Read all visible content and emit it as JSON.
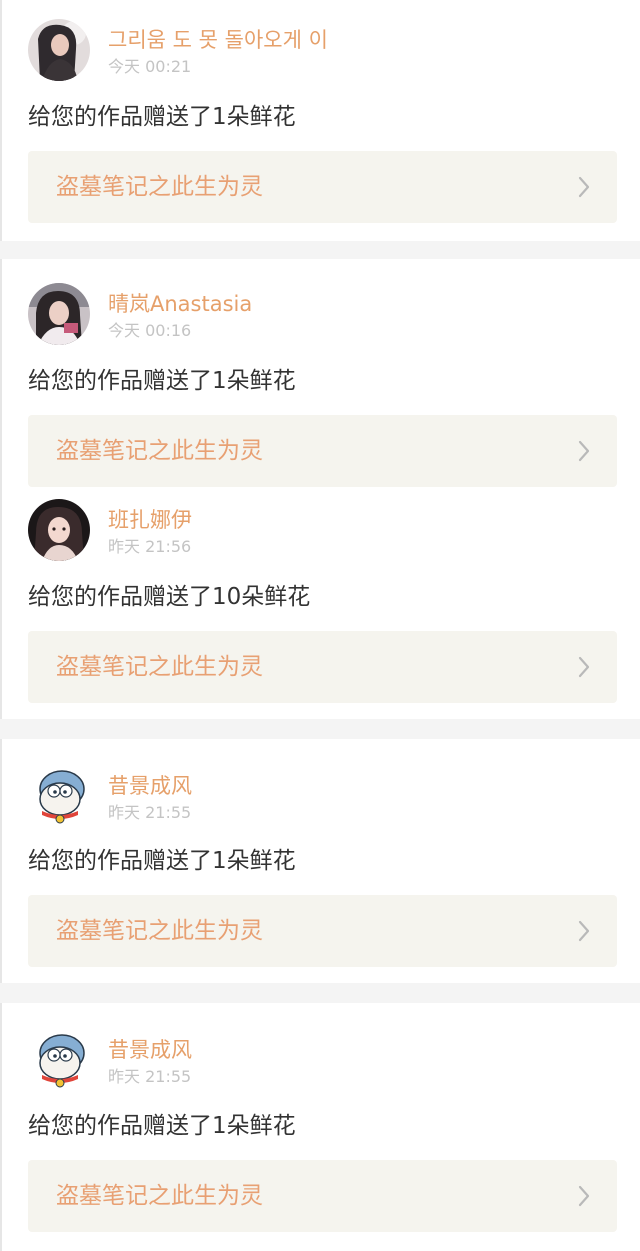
{
  "notifications": [
    {
      "user": "그리움 도 못 돌아오게 이",
      "time": "今天 00:21",
      "message": "给您的作品赠送了1朵鲜花",
      "work_title": "盗墓笔记之此生为灵",
      "avatar": "avatar-photo-girl-1"
    },
    {
      "user": "晴岚Anastasia",
      "time": "今天 00:16",
      "message": "给您的作品赠送了1朵鲜花",
      "work_title": "盗墓笔记之此生为灵",
      "avatar": "avatar-photo-girl-2"
    },
    {
      "user": "班扎娜伊",
      "time": "昨天 21:56",
      "message": "给您的作品赠送了10朵鲜花",
      "work_title": "盗墓笔记之此生为灵",
      "avatar": "avatar-photo-girl-3"
    },
    {
      "user": "昔景成风",
      "time": "昨天 21:55",
      "message": "给您的作品赠送了1朵鲜花",
      "work_title": "盗墓笔记之此生为灵",
      "avatar": "avatar-cartoon-cat"
    },
    {
      "user": "昔景成风",
      "time": "昨天 21:55",
      "message": "给您的作品赠送了1朵鲜花",
      "work_title": "盗墓笔记之此生为灵",
      "avatar": "avatar-cartoon-cat"
    }
  ],
  "icons": {
    "link_arrow": "chevron-right-icon"
  },
  "colors": {
    "username": "#e6a06a",
    "time": "#c4c4c4",
    "message": "#333333",
    "work_title": "#e8a073",
    "work_link_background": "#f5f4ee",
    "separator": "#f4f4f4"
  }
}
